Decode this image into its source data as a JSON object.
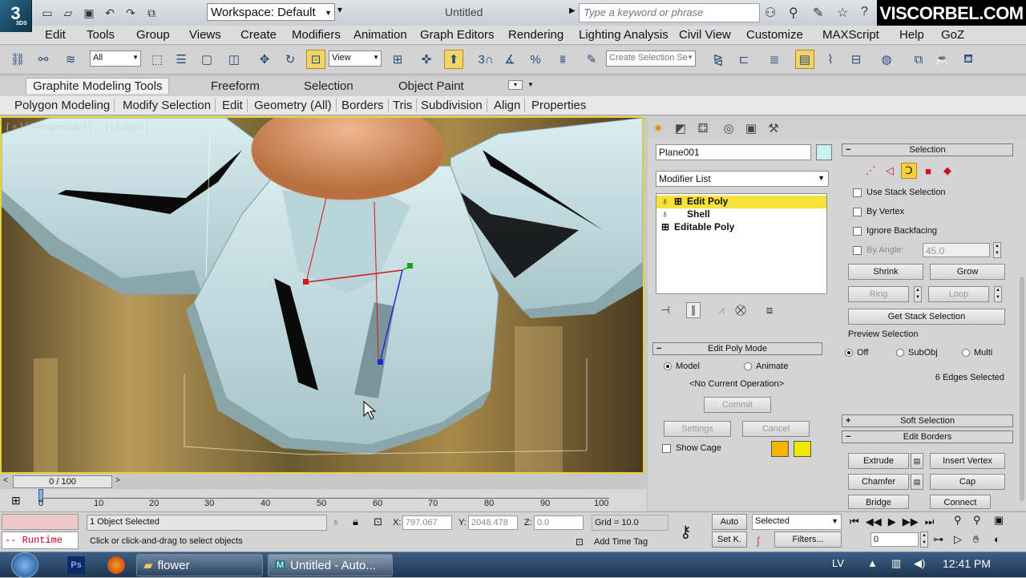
{
  "titlebar": {
    "app_logo": "3",
    "app_logo_sub": "3DS",
    "workspace": "Workspace: Default",
    "title": "Untitled",
    "search_placeholder": "Type a keyword or phrase",
    "brand": "VISCORBEL.COM"
  },
  "menu": [
    "Edit",
    "Tools",
    "Group",
    "Views",
    "Create",
    "Modifiers",
    "Animation",
    "Graph Editors",
    "Rendering",
    "Lighting Analysis",
    "Civil View",
    "Customize",
    "MAXScript",
    "Help",
    "GoZ"
  ],
  "toolbar": {
    "filter": "All",
    "ref_coord": "View",
    "selection_set_placeholder": "Create Selection Se",
    "snap_value": "3",
    "angle_snap": "%"
  },
  "ribbon": {
    "tabs": [
      "Graphite Modeling Tools",
      "Freeform",
      "Selection",
      "Object Paint"
    ],
    "panels": [
      "Polygon Modeling",
      "Modify Selection",
      "Edit",
      "Geometry (All)",
      "Borders",
      "Tris",
      "Subdivision",
      "Align",
      "Properties"
    ]
  },
  "viewport": {
    "label": "[ + ] [ Perspective ] [ ... ] [ Edges ]"
  },
  "command_panel": {
    "object_name": "Plane001",
    "modifier_list": "Modifier List",
    "stack": [
      {
        "label": "Edit Poly",
        "selected": true
      },
      {
        "label": "Shell",
        "selected": false
      },
      {
        "label": "Editable Poly",
        "selected": false
      }
    ],
    "selection": {
      "title": "Selection",
      "use_stack": "Use Stack Selection",
      "by_vertex": "By Vertex",
      "ignore_backfacing": "Ignore Backfacing",
      "by_angle": "By Angle:",
      "angle_value": "45.0",
      "shrink": "Shrink",
      "grow": "Grow",
      "ring": "Ring",
      "loop": "Loop",
      "get_stack": "Get Stack Selection",
      "preview": "Preview Selection",
      "off": "Off",
      "subobj": "SubObj",
      "multi": "Multi",
      "status": "6 Edges Selected"
    },
    "edit_poly_mode": {
      "title": "Edit Poly Mode",
      "model": "Model",
      "animate": "Animate",
      "operation": "<No Current Operation>",
      "commit": "Commit",
      "settings": "Settings",
      "cancel": "Cancel",
      "show_cage": "Show Cage",
      "cage_color_1": "#f4b400",
      "cage_color_2": "#f2e600"
    },
    "soft_selection": "Soft Selection",
    "edit_borders": {
      "title": "Edit Borders",
      "extrude": "Extrude",
      "insert_vertex": "Insert Vertex",
      "chamfer": "Chamfer",
      "cap": "Cap",
      "bridge": "Bridge",
      "connect": "Connect"
    }
  },
  "timeline": {
    "frame": "0 / 100",
    "ticks": [
      "0",
      "10",
      "20",
      "30",
      "40",
      "50",
      "60",
      "70",
      "80",
      "90",
      "100"
    ]
  },
  "status": {
    "maxscript": "-- Runtime",
    "objects": "1 Object Selected",
    "prompt": "Click or click-and-drag to select objects",
    "x_label": "X:",
    "x": "797.067",
    "y_label": "Y:",
    "y": "2048.478",
    "z_label": "Z:",
    "z": "0.0",
    "grid": "Grid = 10.0",
    "add_time_tag": "Add Time Tag",
    "auto": "Auto",
    "setk": "Set K.",
    "selected": "Selected",
    "filters": "Filters...",
    "frame_field": "0"
  },
  "taskbar": {
    "items": [
      "flower",
      "Untitled - Auto..."
    ],
    "lang": "LV",
    "clock": "12:41 PM"
  }
}
